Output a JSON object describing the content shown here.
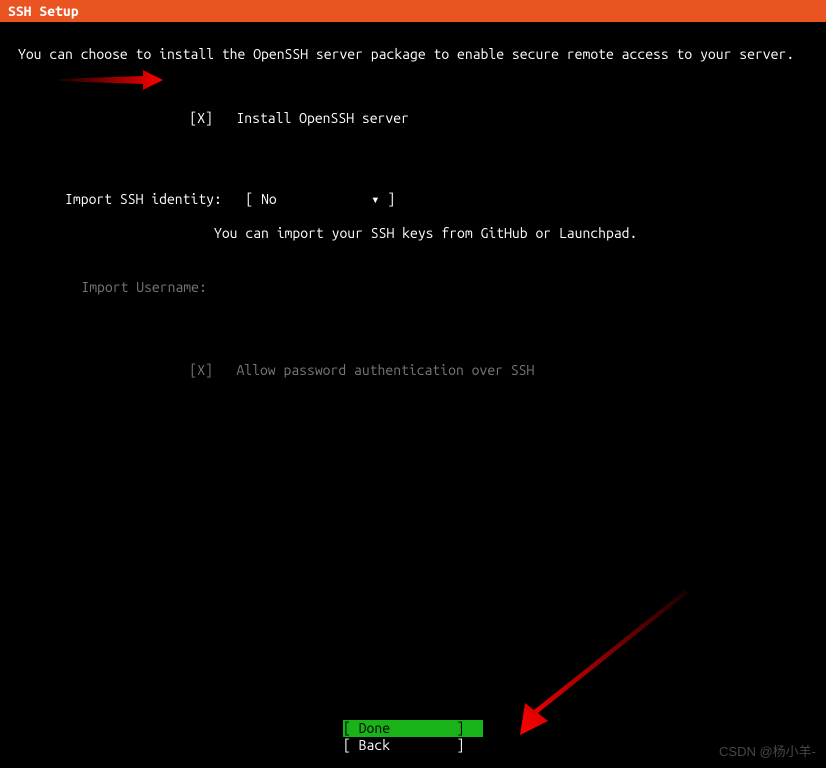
{
  "header": {
    "title": "SSH Setup"
  },
  "intro": "You can choose to install the OpenSSH server package to enable secure remote access to your server.",
  "install": {
    "checkbox": "[X]",
    "label": "Install OpenSSH server"
  },
  "identity": {
    "label": "Import SSH identity:",
    "bracket_open": "[ ",
    "value": "No",
    "caret": "▾",
    "bracket_close": " ]",
    "help": "You can import your SSH keys from GitHub or Launchpad."
  },
  "import_user": {
    "label": "Import Username:"
  },
  "allow_pw": {
    "checkbox": "[X]",
    "label": "Allow password authentication over SSH"
  },
  "buttons": {
    "done": {
      "bracket_open": "[ ",
      "label": "Done",
      "bracket_close": " ]"
    },
    "back": {
      "bracket_open": "[ ",
      "label": "Back",
      "bracket_close": " ]"
    }
  },
  "watermark": "CSDN @杨小羊-"
}
